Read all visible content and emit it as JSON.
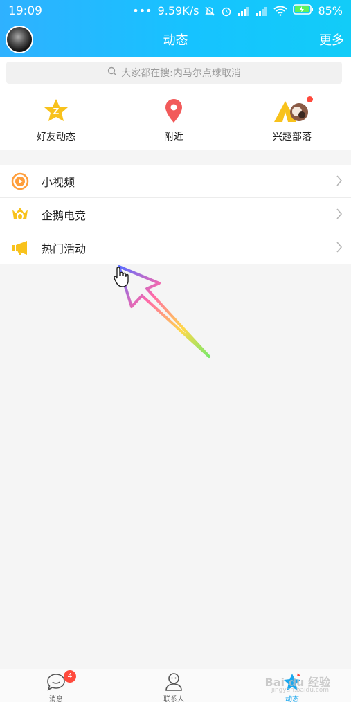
{
  "status_bar": {
    "time": "19:09",
    "network_speed": "9.59K/s",
    "battery": "85%"
  },
  "header": {
    "title": "动态",
    "more_label": "更多"
  },
  "search": {
    "placeholder": "大家都在搜:内马尔点球取消"
  },
  "quick_entries": [
    {
      "label": "好友动态",
      "icon": "friends-star-icon",
      "color": "#f8c21c"
    },
    {
      "label": "附近",
      "icon": "location-pin-icon",
      "color": "#f25a5a"
    },
    {
      "label": "兴趣部落",
      "icon": "tribe-tent-icon",
      "color": "#f8c21c",
      "has_dot": true
    }
  ],
  "list": [
    {
      "label": "小视频",
      "icon": "video-play-icon",
      "color": "#ff9e3b"
    },
    {
      "label": "企鹅电竞",
      "icon": "esports-crown-icon",
      "color": "#f8c21c"
    },
    {
      "label": "热门活动",
      "icon": "megaphone-icon",
      "color": "#f8c21c"
    }
  ],
  "tabs": [
    {
      "label": "消息",
      "icon": "chat-icon",
      "badge": "4",
      "active": false
    },
    {
      "label": "联系人",
      "icon": "contacts-icon",
      "active": false
    },
    {
      "label": "动态",
      "icon": "star-icon",
      "active": true
    }
  ],
  "watermark": {
    "text": "Bai du 经验",
    "sub": "jingyan.baidu.com"
  },
  "colors": {
    "header_start": "#2fb1ff",
    "header_end": "#12ccf8",
    "accent": "#1aa7ee",
    "badge": "#ff4a3d"
  }
}
